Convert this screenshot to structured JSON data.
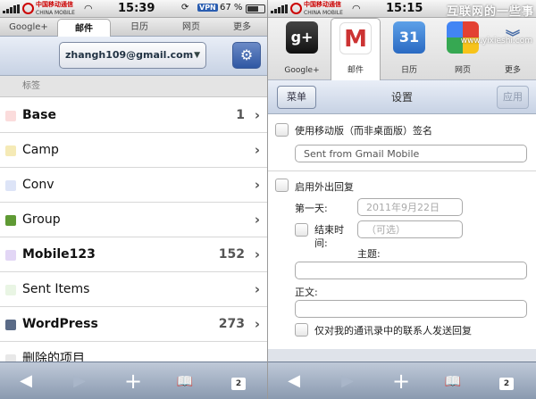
{
  "left": {
    "status": {
      "carrier_cn": "中国移动通信",
      "carrier_en": "CHINA MOBILE",
      "time": "15:39",
      "vpn": "VPN",
      "battery": "67 %"
    },
    "tabs": [
      "Google+",
      "邮件",
      "日历",
      "网页",
      "更多"
    ],
    "active_tab": 1,
    "account": "zhangh109@gmail.com",
    "labels_header": "标签",
    "labels": [
      {
        "name": "Base",
        "count": "1",
        "bold": true,
        "color": "#fbdcdc"
      },
      {
        "name": "Camp",
        "count": "",
        "bold": false,
        "color": "#f5eab6"
      },
      {
        "name": "Conv",
        "count": "",
        "bold": false,
        "color": "#dde4f7"
      },
      {
        "name": "Group",
        "count": "",
        "bold": false,
        "color": "#5f9a34"
      },
      {
        "name": "Mobile123",
        "count": "152",
        "bold": true,
        "color": "#e2d6f5"
      },
      {
        "name": "Sent Items",
        "count": "",
        "bold": false,
        "color": "#e9f5e4"
      },
      {
        "name": "WordPress",
        "count": "273",
        "bold": true,
        "color": "#5a6b87"
      },
      {
        "name": "删除的项目",
        "count": "",
        "bold": false,
        "color": "#e8e8e8"
      }
    ]
  },
  "right": {
    "status": {
      "carrier_cn": "中国移动通信",
      "carrier_en": "CHINA MOBILE",
      "time": "15:15"
    },
    "watermark": "互联网的一些事",
    "watermark_url": "www.yixieshi.com",
    "apps": [
      {
        "label": "Google+",
        "glyph": "g+"
      },
      {
        "label": "邮件",
        "glyph": "M"
      },
      {
        "label": "日历",
        "glyph": "31"
      },
      {
        "label": "网页",
        "glyph": ""
      },
      {
        "label": "更多",
        "glyph": "︾"
      }
    ],
    "nav": {
      "back": "菜单",
      "title": "设置",
      "apply": "应用"
    },
    "settings": {
      "mobile_sig_label": "使用移动版（而非桌面版）签名",
      "signature_value": "Sent from Gmail Mobile",
      "vacation_label": "启用外出回复",
      "first_day_label": "第一天:",
      "first_day_value": "2011年9月22日",
      "end_time_label_1": "结束时",
      "end_time_label_2": "间:",
      "end_time_placeholder": "（可选）",
      "subject_label": "主题:",
      "body_label": "正文:",
      "contacts_only_label": "仅对我的通讯录中的联系人发送回复"
    }
  },
  "toolbar": {
    "back": "◀",
    "forward": "▶",
    "add": "+",
    "bookmarks": "📖",
    "pages": "2"
  }
}
